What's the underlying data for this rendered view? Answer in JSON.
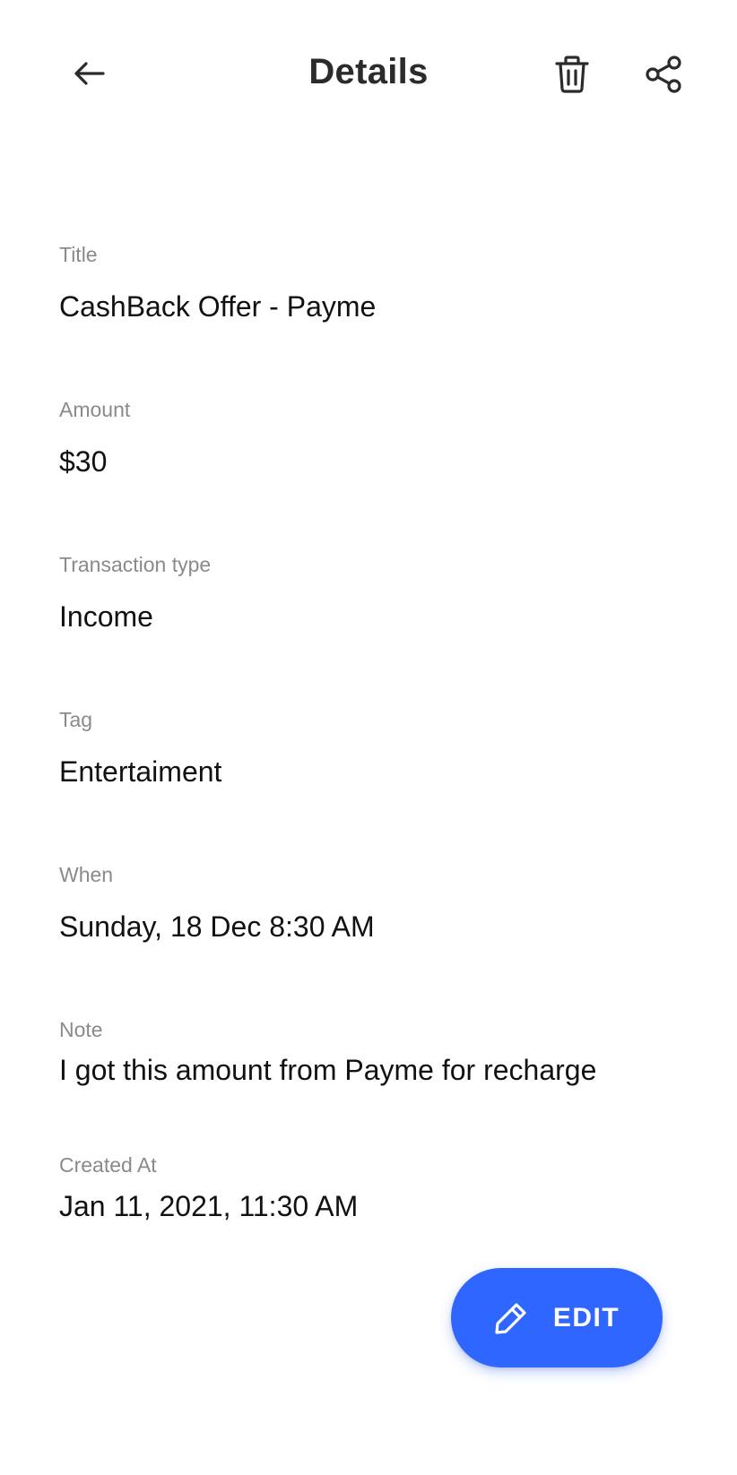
{
  "header": {
    "title": "Details",
    "back_icon": "arrow-left-icon",
    "delete_icon": "trash-icon",
    "share_icon": "share-icon"
  },
  "fields": {
    "title": {
      "label": "Title",
      "value": "CashBack Offer - Payme"
    },
    "amount": {
      "label": "Amount",
      "value": "$30"
    },
    "transaction_type": {
      "label": "Transaction type",
      "value": "Income"
    },
    "tag": {
      "label": "Tag",
      "value": "Entertaiment"
    },
    "when": {
      "label": "When",
      "value": "Sunday, 18 Dec 8:30 AM"
    },
    "note": {
      "label": "Note",
      "value": "I got this amount from Payme for recharge"
    },
    "created_at": {
      "label": "Created At",
      "value": "Jan 11, 2021, 11:30 AM"
    }
  },
  "edit_button": {
    "label": "EDIT",
    "icon": "pencil-icon",
    "color": "#2f66ff"
  }
}
